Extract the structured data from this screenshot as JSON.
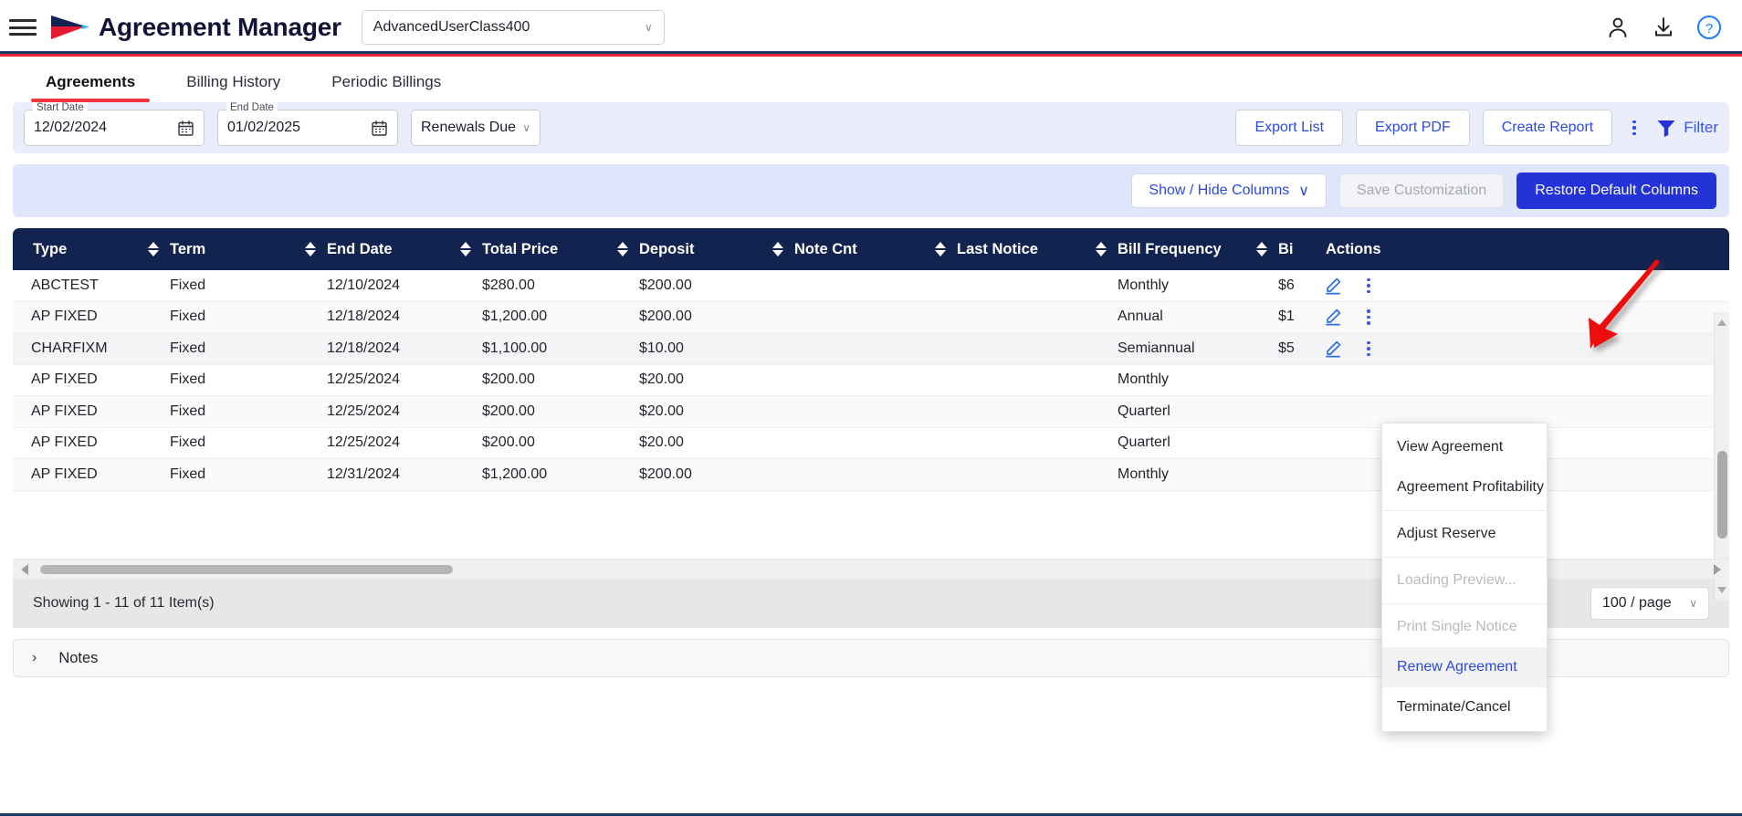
{
  "header": {
    "menu_icon": "hamburger-menu-icon",
    "logo_icon": "arrow-logo-icon",
    "title": "Agreement Manager",
    "user_class": {
      "value": "AdvancedUserClass400",
      "chevron": "∨"
    },
    "icons": [
      {
        "name": "user-account-icon",
        "glyph": "person"
      },
      {
        "name": "download-icon",
        "glyph": "download"
      },
      {
        "name": "help-icon",
        "glyph": "question"
      }
    ]
  },
  "tabs": [
    {
      "label": "Agreements",
      "active": true
    },
    {
      "label": "Billing History",
      "active": false
    },
    {
      "label": "Periodic Billings",
      "active": false
    }
  ],
  "filters": {
    "start_date": {
      "legend": "Start Date",
      "value": "12/02/2024",
      "placeholder": "MM/DD/YYYY"
    },
    "end_date": {
      "legend": "End Date",
      "value": "01/02/2025",
      "placeholder": "MM/DD/YYYY"
    },
    "status_select": {
      "value": "Renewals Due",
      "chevron": "∨"
    },
    "buttons": [
      {
        "label": "Export List",
        "name": "export-list-button"
      },
      {
        "label": "Export PDF",
        "name": "export-pdf-button"
      },
      {
        "label": "Create Report",
        "name": "create-report-button"
      }
    ],
    "filter_label": "Filter"
  },
  "columns_bar": {
    "show_hide": "Show / Hide Columns",
    "show_hide_chevron": "∨",
    "save_customization": "Save Customization",
    "restore_defaults": "Restore Default Columns"
  },
  "table": {
    "headers": [
      "Type",
      "Term",
      "End Date",
      "Total Price",
      "Deposit",
      "Note Cnt",
      "Last Notice",
      "Bill Frequency",
      "Bi",
      "Actions"
    ],
    "rows": [
      {
        "type": "ABCTEST",
        "term": "Fixed",
        "end_date": "12/10/2024",
        "total_price": "$280.00",
        "deposit": "$200.00",
        "note_cnt": "",
        "last_notice": "",
        "bill_frequency": "Monthly",
        "bi": "$6"
      },
      {
        "type": "AP FIXED",
        "term": "Fixed",
        "end_date": "12/18/2024",
        "total_price": "$1,200.00",
        "deposit": "$200.00",
        "note_cnt": "",
        "last_notice": "",
        "bill_frequency": "Annual",
        "bi": "$1"
      },
      {
        "type": "CHARFIXM",
        "term": "Fixed",
        "end_date": "12/18/2024",
        "total_price": "$1,100.00",
        "deposit": "$10.00",
        "note_cnt": "",
        "last_notice": "",
        "bill_frequency": "Semiannual",
        "bi": "$5"
      },
      {
        "type": "AP FIXED",
        "term": "Fixed",
        "end_date": "12/25/2024",
        "total_price": "$200.00",
        "deposit": "$20.00",
        "note_cnt": "",
        "last_notice": "",
        "bill_frequency": "Monthly",
        "bi": ""
      },
      {
        "type": "AP FIXED",
        "term": "Fixed",
        "end_date": "12/25/2024",
        "total_price": "$200.00",
        "deposit": "$20.00",
        "note_cnt": "",
        "last_notice": "",
        "bill_frequency": "Quarterl",
        "bi": ""
      },
      {
        "type": "AP FIXED",
        "term": "Fixed",
        "end_date": "12/25/2024",
        "total_price": "$200.00",
        "deposit": "$20.00",
        "note_cnt": "",
        "last_notice": "",
        "bill_frequency": "Quarterl",
        "bi": ""
      },
      {
        "type": "AP FIXED",
        "term": "Fixed",
        "end_date": "12/31/2024",
        "total_price": "$1,200.00",
        "deposit": "$200.00",
        "note_cnt": "",
        "last_notice": "",
        "bill_frequency": "Monthly",
        "bi": ""
      }
    ]
  },
  "context_menu": {
    "items": [
      {
        "label": "View Agreement",
        "state": "normal"
      },
      {
        "label": "Agreement Profitability",
        "state": "normal"
      },
      {
        "label": "Adjust Reserve",
        "state": "normal"
      },
      {
        "label": "Loading Preview...",
        "state": "disabled"
      },
      {
        "label": "Print Single Notice",
        "state": "disabled"
      },
      {
        "label": "Renew Agreement",
        "state": "active"
      },
      {
        "label": "Terminate/Cancel",
        "state": "normal"
      }
    ]
  },
  "footer": {
    "showing": "Showing 1 - 11 of 11 Item(s)",
    "page_size": "100 / page",
    "page_size_chevron": "∨"
  },
  "notes": {
    "label": "Notes",
    "caret": "›"
  },
  "colors": {
    "brand_navy": "#12234f",
    "brand_red": "#f5333f",
    "accent_blue": "#2b49e0",
    "primary_button": "#2433d8",
    "filter_bar_bg": "#eaeefb",
    "columns_bar_bg": "#dfe5fb",
    "annotation_arrow": "#ee1111"
  }
}
